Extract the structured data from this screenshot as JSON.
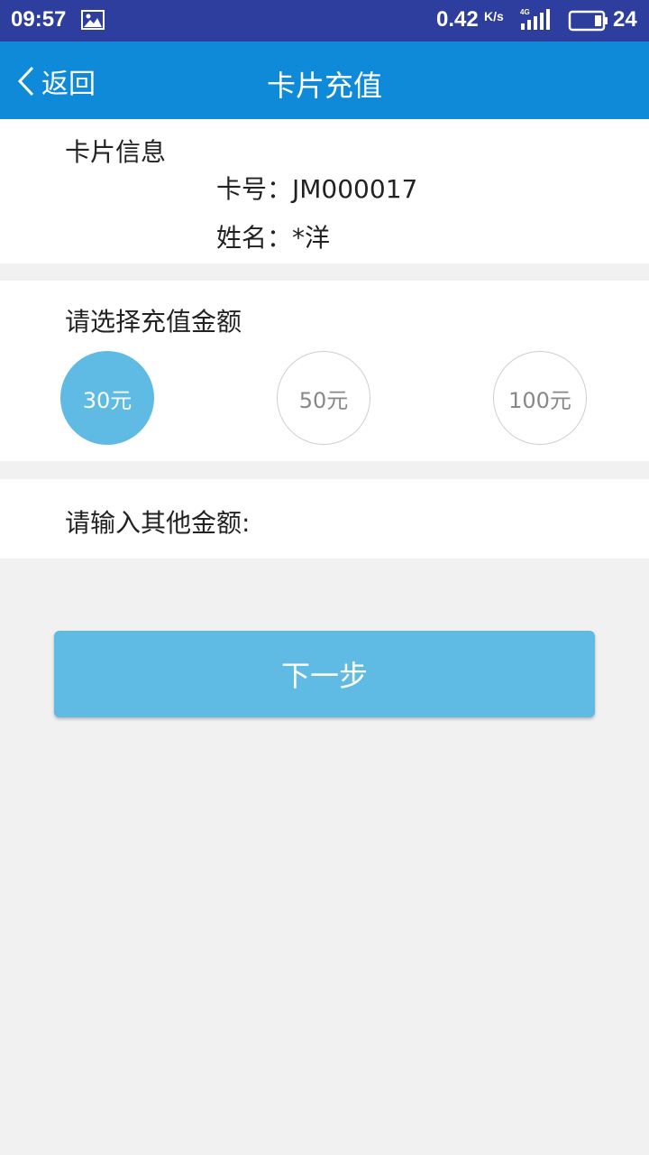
{
  "status_bar": {
    "time": "09:57",
    "speed": "0.42",
    "speed_unit": "K/s",
    "network": "4G",
    "battery": "24"
  },
  "app_bar": {
    "back_label": "返回",
    "title": "卡片充值"
  },
  "card_info": {
    "title": "卡片信息",
    "card_no_label": "卡号：",
    "card_no": "JM000017",
    "name_label": "姓名：",
    "name": "*洋"
  },
  "amount": {
    "title": "请选择充值金额",
    "options": [
      {
        "label": "30元",
        "selected": true
      },
      {
        "label": "50元",
        "selected": false
      },
      {
        "label": "100元",
        "selected": false
      }
    ]
  },
  "other_amount": {
    "label": "请输入其他金额:",
    "value": "",
    "placeholder": ""
  },
  "next_button": {
    "label": "下一步"
  },
  "colors": {
    "status_bar": "#2d3e9e",
    "app_bar": "#0f8ad8",
    "accent": "#5fbbe3",
    "background": "#f1f1f1"
  }
}
